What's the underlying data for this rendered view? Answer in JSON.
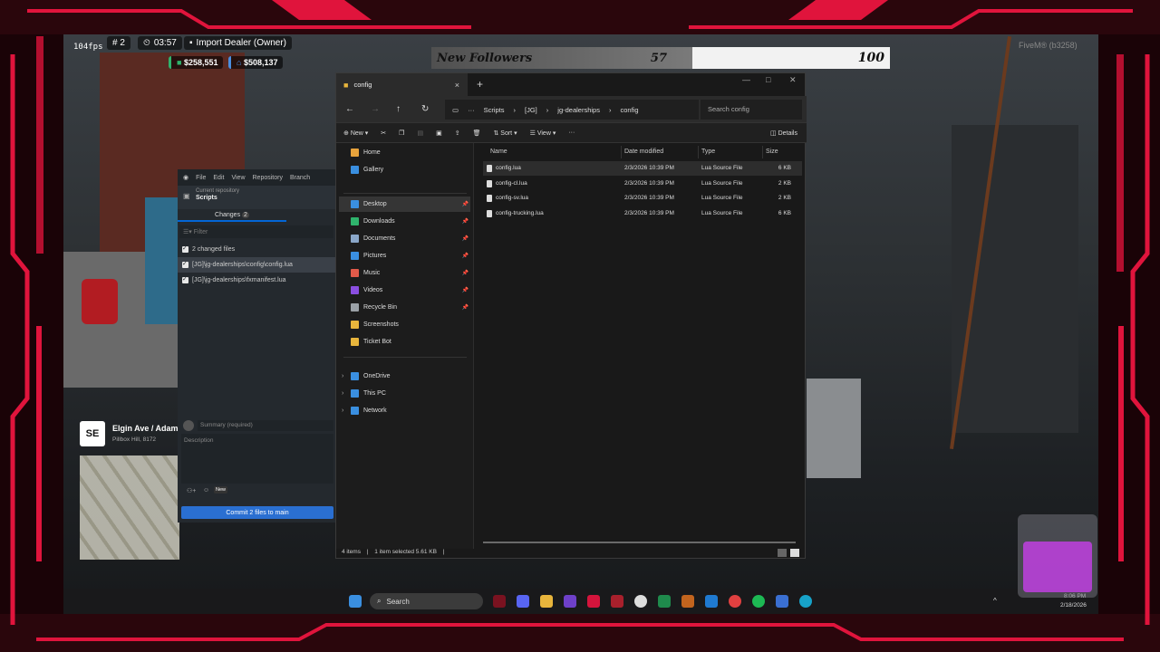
{
  "hud": {
    "fps": "104fps",
    "player_id": "# 2",
    "time": "03:57",
    "job": "Import Dealer (Owner)",
    "cash": "$258,551",
    "bank": "$508,137",
    "server": "FiveM® (b3258)"
  },
  "followers": {
    "label": "New Followers",
    "current": "57",
    "goal": "100",
    "progress": 0.57
  },
  "github": {
    "menu": [
      "File",
      "Edit",
      "View",
      "Repository",
      "Branch"
    ],
    "repo_label": "Current repository",
    "repo_name": "Scripts",
    "tab_label": "Changes",
    "tab_count": "2",
    "filter_placeholder": "Filter",
    "changed_files_label": "2 changed files",
    "files": [
      "[JG]\\jg-dealerships\\config\\config.lua",
      "[JG]\\jg-dealerships\\fxmanifest.lua"
    ],
    "summary_placeholder": "Summary (required)",
    "description_placeholder": "Description",
    "new_badge": "New",
    "commit_label": "Commit 2 files to main"
  },
  "location": {
    "badge": "SE",
    "street": "Elgin Ave / Adam",
    "area": "Pillbox Hill, 8172"
  },
  "explorer": {
    "tab_title": "config",
    "tab_close": "×",
    "tab_add": "+",
    "breadcrumbs": [
      "Scripts",
      "[JG]",
      "jg-dealerships",
      "config"
    ],
    "search_placeholder": "Search config",
    "toolbar": {
      "new": "New",
      "sort": "Sort",
      "view": "View",
      "more": "···",
      "details": "Details"
    },
    "sidebar": [
      {
        "label": "Home",
        "icon": "home-icon",
        "color": "#e8a33c"
      },
      {
        "label": "Gallery",
        "icon": "gallery-icon",
        "color": "#3a8fe0"
      },
      {
        "label": "Desktop",
        "icon": "desktop-icon",
        "color": "#3a8fe0",
        "pinned": true,
        "selected": true
      },
      {
        "label": "Downloads",
        "icon": "download-icon",
        "color": "#2fb36c",
        "pinned": true
      },
      {
        "label": "Documents",
        "icon": "documents-icon",
        "color": "#8aa6c8",
        "pinned": true
      },
      {
        "label": "Pictures",
        "icon": "pictures-icon",
        "color": "#3a8fe0",
        "pinned": true
      },
      {
        "label": "Music",
        "icon": "music-icon",
        "color": "#e25a4a",
        "pinned": true
      },
      {
        "label": "Videos",
        "icon": "videos-icon",
        "color": "#8a4ee0",
        "pinned": true
      },
      {
        "label": "Recycle Bin",
        "icon": "recycle-bin-icon",
        "color": "#9aa0a6",
        "pinned": true
      },
      {
        "label": "Screenshots",
        "icon": "folder-icon",
        "color": "#e8b53c"
      },
      {
        "label": "Ticket Bot",
        "icon": "folder-icon",
        "color": "#e8b53c"
      },
      {
        "label": "OneDrive",
        "icon": "cloud-icon",
        "color": "#3a8fe0"
      },
      {
        "label": "This PC",
        "icon": "computer-icon",
        "color": "#3a8fe0"
      },
      {
        "label": "Network",
        "icon": "network-icon",
        "color": "#3a8fe0"
      }
    ],
    "columns": [
      "Name",
      "Date modified",
      "Type",
      "Size"
    ],
    "files": [
      {
        "name": "config.lua",
        "date": "2/3/2026 10:39 PM",
        "type": "Lua Source File",
        "size": "6 KB"
      },
      {
        "name": "config-cl.lua",
        "date": "2/3/2026 10:39 PM",
        "type": "Lua Source File",
        "size": "2 KB"
      },
      {
        "name": "config-sv.lua",
        "date": "2/3/2026 10:39 PM",
        "type": "Lua Source File",
        "size": "2 KB"
      },
      {
        "name": "config-trucking.lua",
        "date": "2/3/2026 10:39 PM",
        "type": "Lua Source File",
        "size": "6 KB"
      }
    ],
    "status": {
      "count": "4 items",
      "selected": "1 item selected  5.61 KB"
    }
  },
  "taskbar": {
    "search_label": "Search",
    "time": "8:06 PM",
    "date": "2/18/2026"
  },
  "colors": {
    "frame_red": "#e0143c",
    "explorer_bg": "#191919",
    "commit_blue": "#2a6fd1"
  }
}
